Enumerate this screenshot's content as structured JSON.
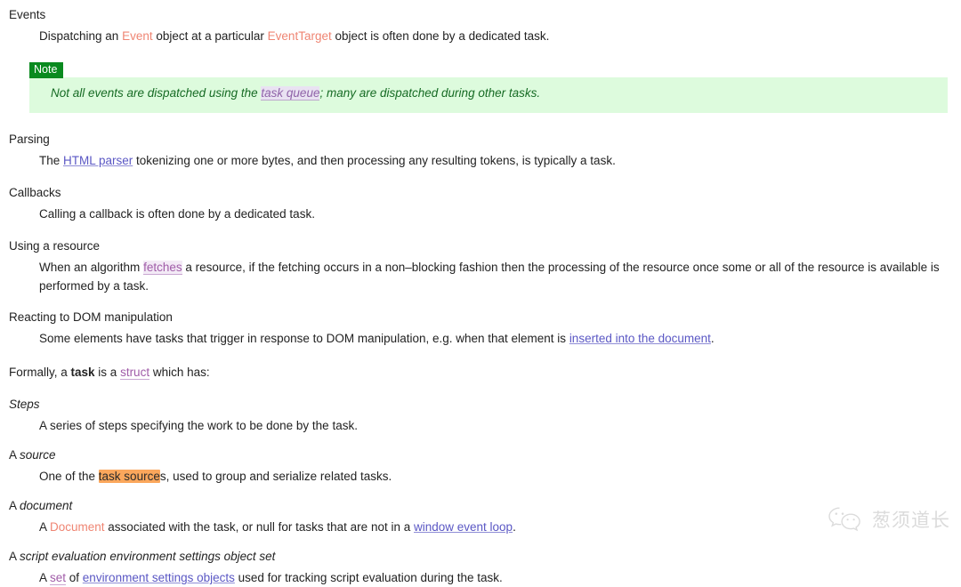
{
  "sections": {
    "events": {
      "heading": "Events",
      "body_pre": "Dispatching an ",
      "idl1": "Event",
      "body_mid": " object at a particular ",
      "idl2": "EventTarget",
      "body_post": " object is often done by a dedicated task."
    },
    "note": {
      "badge": "Note",
      "pre": "Not all events are dispatched using the ",
      "link": "task queue",
      "post": "; many are dispatched during other tasks."
    },
    "parsing": {
      "heading": "Parsing",
      "pre": "The ",
      "link": "HTML parser",
      "post": " tokenizing one or more bytes, and then processing any resulting tokens, is typically a task."
    },
    "callbacks": {
      "heading": "Callbacks",
      "body": "Calling a callback is often done by a dedicated task."
    },
    "using_a_resource": {
      "heading": "Using a resource",
      "pre": "When an algorithm ",
      "link": "fetches",
      "post": " a resource, if the fetching occurs in a non–blocking fashion then the processing of the resource once some or all of the resource is available is performed by a task."
    },
    "reacting_dom": {
      "heading": "Reacting to DOM manipulation",
      "pre": "Some elements have tasks that trigger in response to DOM manipulation, e.g. when that element is ",
      "link": "inserted into the document",
      "post": "."
    },
    "formally": {
      "pre": "Formally, a ",
      "bold": "task",
      "mid": " is a ",
      "link": "struct",
      "post": " which has:"
    },
    "steps": {
      "heading": "Steps",
      "body": "A series of steps specifying the work to be done by the task."
    },
    "a_source": {
      "heading_pre": "A ",
      "heading_ital": "source",
      "body_pre": "One of the ",
      "highlight": "task source",
      "body_post": "s, used to group and serialize related tasks."
    },
    "a_document": {
      "heading_pre": "A ",
      "heading_ital": "document",
      "body_pre": "A ",
      "idl": "Document",
      "body_mid": " associated with the task, or null for tasks that are not in a ",
      "link": "window event loop",
      "body_post": "."
    },
    "script_env": {
      "heading_pre": "A ",
      "heading_ital": "script evaluation environment settings object set",
      "body_pre": "A ",
      "link1": "set",
      "body_mid": " of ",
      "link2": "environment settings objects",
      "body_post": " used for tracking script evaluation during the task."
    }
  },
  "watermark": {
    "text": "葱须道长",
    "logo_name": "wechat-logo"
  },
  "colors": {
    "idl_type": "#ef8573",
    "concept_link": "#a05ca8",
    "spec_link": "#5a57c4",
    "note_badge_bg": "#0a8a1f",
    "note_body_bg": "#ddfbdd",
    "note_text": "#166b24",
    "highlight_bg": "#fba75c",
    "body_text": "#222222"
  }
}
